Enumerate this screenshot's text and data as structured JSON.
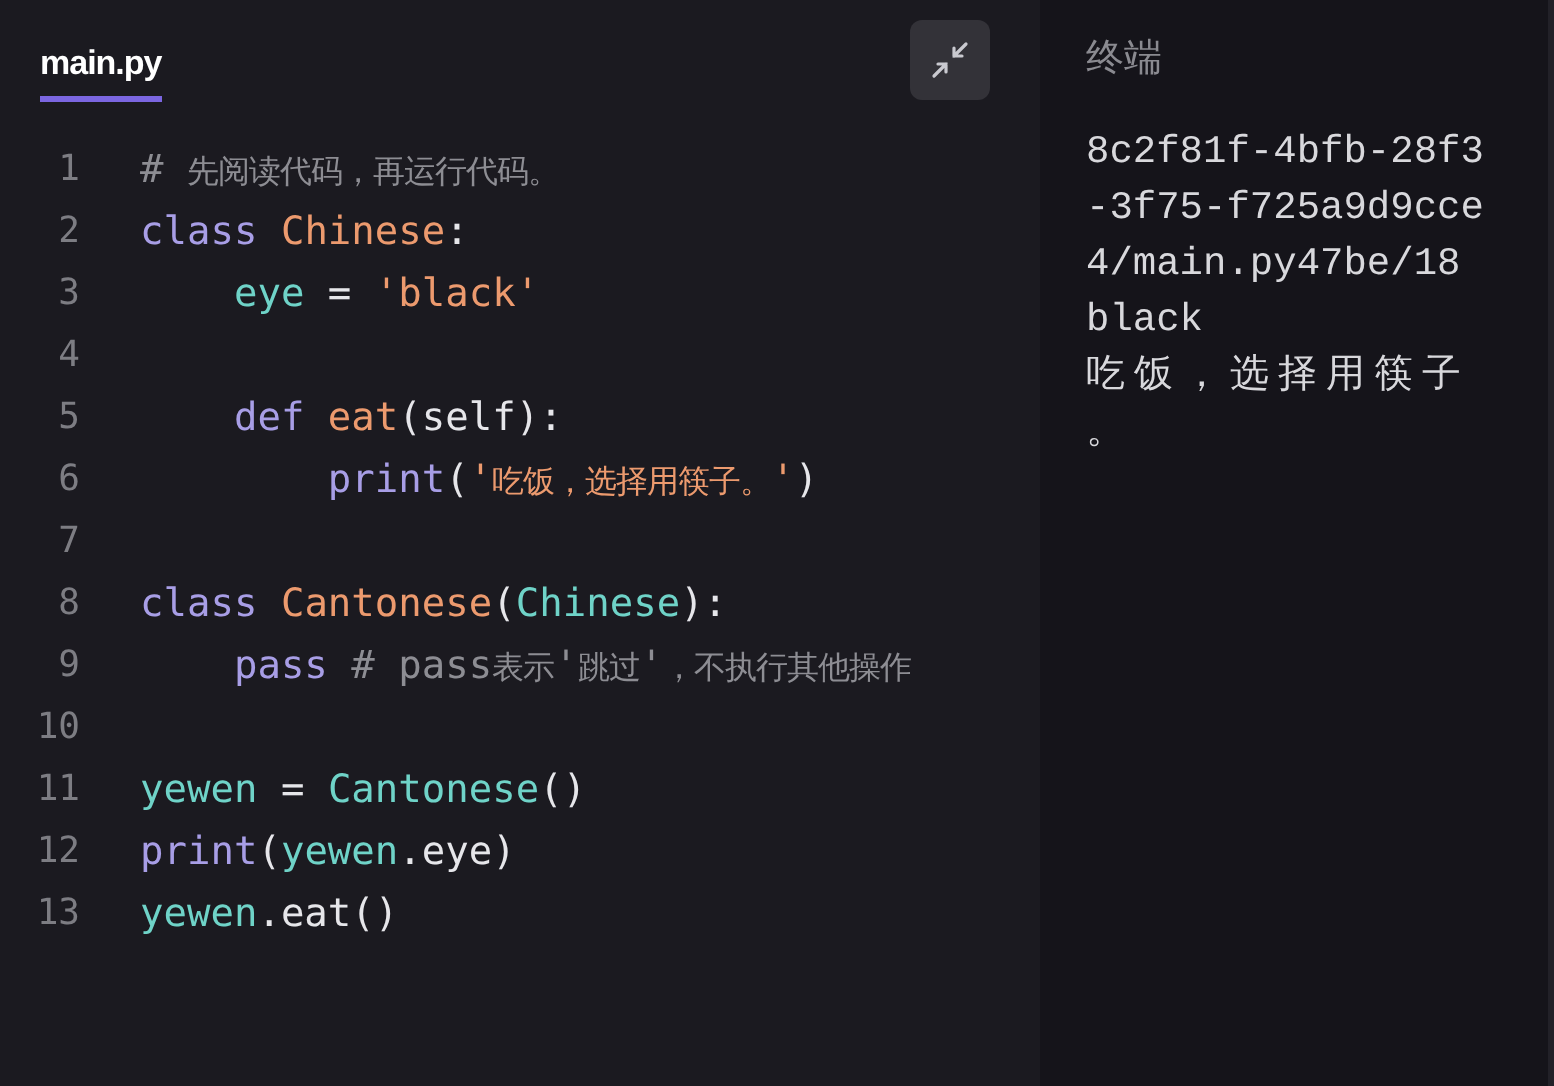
{
  "editor": {
    "tab": {
      "label": "main.py",
      "selected": true
    },
    "lines": [
      {
        "number": "1",
        "tokens": [
          {
            "kind": "comment",
            "text": "# 先阅读代码，再运行代码。"
          }
        ]
      },
      {
        "number": "2",
        "tokens": [
          {
            "kind": "keyword",
            "text": "class "
          },
          {
            "kind": "classname",
            "text": "Chinese"
          },
          {
            "kind": "plain",
            "text": ":"
          }
        ]
      },
      {
        "number": "3",
        "tokens": [
          {
            "kind": "name",
            "text": "    eye"
          },
          {
            "kind": "plain",
            "text": " = "
          },
          {
            "kind": "string",
            "text": "'black'"
          }
        ]
      },
      {
        "number": "4"
      },
      {
        "number": "5",
        "tokens": [
          {
            "kind": "keyword",
            "text": "    def "
          },
          {
            "kind": "classname",
            "text": "eat"
          },
          {
            "kind": "plain",
            "text": "(self):"
          }
        ]
      },
      {
        "number": "6",
        "tokens": [
          {
            "kind": "keyword",
            "text": "        print"
          },
          {
            "kind": "plain",
            "text": "("
          },
          {
            "kind": "string",
            "text": "'吃饭，选择用筷子。'"
          },
          {
            "kind": "plain",
            "text": ")"
          }
        ]
      },
      {
        "number": "7"
      },
      {
        "number": "8",
        "tokens": [
          {
            "kind": "keyword",
            "text": "class "
          },
          {
            "kind": "classname",
            "text": "Cantonese"
          },
          {
            "kind": "plain",
            "text": "("
          },
          {
            "kind": "name",
            "text": "Chinese"
          },
          {
            "kind": "plain",
            "text": "):"
          }
        ]
      },
      {
        "number": "9",
        "tokens": [
          {
            "kind": "keyword",
            "text": "    pass "
          },
          {
            "kind": "comment",
            "text": "# pass表示'跳过'，不执行其他操作"
          }
        ]
      },
      {
        "number": "10"
      },
      {
        "number": "11",
        "tokens": [
          {
            "kind": "name",
            "text": "yewen"
          },
          {
            "kind": "plain",
            "text": " = "
          },
          {
            "kind": "name",
            "text": "Cantonese"
          },
          {
            "kind": "plain",
            "text": "()"
          }
        ]
      },
      {
        "number": "12",
        "tokens": [
          {
            "kind": "keyword",
            "text": "print"
          },
          {
            "kind": "plain",
            "text": "("
          },
          {
            "kind": "name",
            "text": "yewen"
          },
          {
            "kind": "plain",
            "text": ".eye)"
          }
        ]
      },
      {
        "number": "13",
        "tokens": [
          {
            "kind": "name",
            "text": "yewen"
          },
          {
            "kind": "plain",
            "text": ".eat()"
          }
        ]
      }
    ]
  },
  "terminal": {
    "title": "终端",
    "output": [
      "8c2f81f-4bfb-28f3",
      "-3f75-f725a9d9cce",
      "4/main.py47be/18",
      "black",
      "吃饭，选择用筷子",
      "。"
    ]
  }
}
